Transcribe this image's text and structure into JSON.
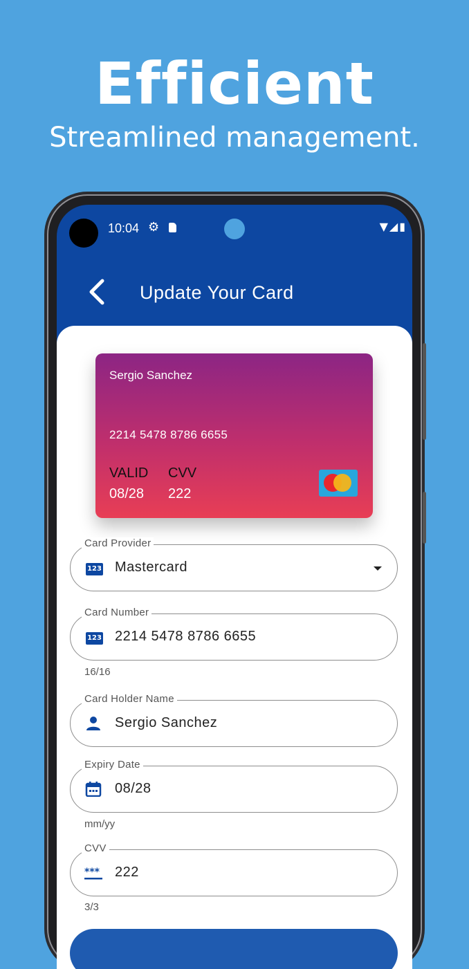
{
  "promo": {
    "headline": "Efficient",
    "subline": "Streamlined management."
  },
  "status_bar": {
    "time": "10:04"
  },
  "app_bar": {
    "title": "Update Your Card"
  },
  "card_preview": {
    "holder": "Sergio Sanchez",
    "number": "2214 5478 8786 6655",
    "valid_label": "VALID",
    "cvv_label": "CVV",
    "valid": "08/28",
    "cvv": "222",
    "gradient": [
      "#8c2584",
      "#e83e55"
    ]
  },
  "form": {
    "provider": {
      "label": "Card Provider",
      "value": "Mastercard"
    },
    "number": {
      "label": "Card Number",
      "value": "2214 5478 8786 6655",
      "helper": "16/16"
    },
    "holder": {
      "label": "Card Holder Name",
      "value": "Sergio Sanchez"
    },
    "expiry": {
      "label": "Expiry Date",
      "value": "08/28",
      "helper": "mm/yy"
    },
    "cvv": {
      "label": "CVV",
      "value": "222",
      "helper": "3/3"
    }
  },
  "colors": {
    "background": "#4fa3df",
    "app_bar": "#0d47a1",
    "accent": "#0d47a1"
  }
}
